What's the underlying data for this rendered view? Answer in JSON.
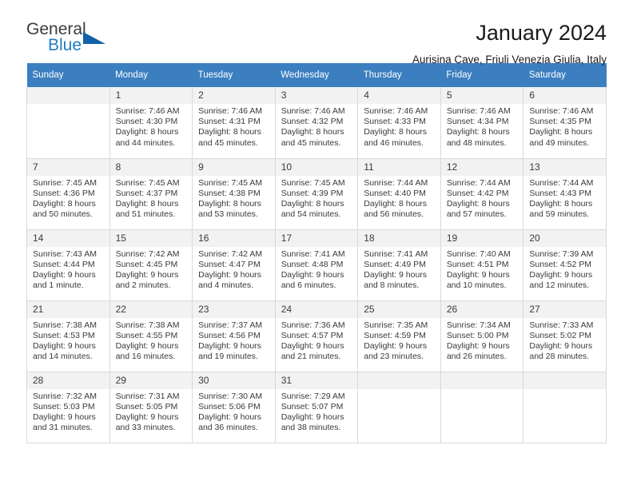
{
  "brand": {
    "name_part1": "General",
    "name_part2": "Blue",
    "triangle_color": "#1162a8",
    "blue_color": "#1f7cc4"
  },
  "header": {
    "title": "January 2024",
    "location": "Aurisina Cave, Friuli Venezia Giulia, Italy"
  },
  "theme": {
    "header_row_bg": "#3c7fc0",
    "daynum_bg": "#f2f2f2",
    "cell_border": "#d9d9d9",
    "text": "#3a3a3a"
  },
  "weekday_headers": [
    "Sunday",
    "Monday",
    "Tuesday",
    "Wednesday",
    "Thursday",
    "Friday",
    "Saturday"
  ],
  "weeks": [
    [
      {
        "day": "",
        "empty": true,
        "sunrise": "",
        "sunset": "",
        "daylight1": "",
        "daylight2": ""
      },
      {
        "day": "1",
        "sunrise": "Sunrise: 7:46 AM",
        "sunset": "Sunset: 4:30 PM",
        "daylight1": "Daylight: 8 hours",
        "daylight2": "and 44 minutes."
      },
      {
        "day": "2",
        "sunrise": "Sunrise: 7:46 AM",
        "sunset": "Sunset: 4:31 PM",
        "daylight1": "Daylight: 8 hours",
        "daylight2": "and 45 minutes."
      },
      {
        "day": "3",
        "sunrise": "Sunrise: 7:46 AM",
        "sunset": "Sunset: 4:32 PM",
        "daylight1": "Daylight: 8 hours",
        "daylight2": "and 45 minutes."
      },
      {
        "day": "4",
        "sunrise": "Sunrise: 7:46 AM",
        "sunset": "Sunset: 4:33 PM",
        "daylight1": "Daylight: 8 hours",
        "daylight2": "and 46 minutes."
      },
      {
        "day": "5",
        "sunrise": "Sunrise: 7:46 AM",
        "sunset": "Sunset: 4:34 PM",
        "daylight1": "Daylight: 8 hours",
        "daylight2": "and 48 minutes."
      },
      {
        "day": "6",
        "sunrise": "Sunrise: 7:46 AM",
        "sunset": "Sunset: 4:35 PM",
        "daylight1": "Daylight: 8 hours",
        "daylight2": "and 49 minutes."
      }
    ],
    [
      {
        "day": "7",
        "sunrise": "Sunrise: 7:45 AM",
        "sunset": "Sunset: 4:36 PM",
        "daylight1": "Daylight: 8 hours",
        "daylight2": "and 50 minutes."
      },
      {
        "day": "8",
        "sunrise": "Sunrise: 7:45 AM",
        "sunset": "Sunset: 4:37 PM",
        "daylight1": "Daylight: 8 hours",
        "daylight2": "and 51 minutes."
      },
      {
        "day": "9",
        "sunrise": "Sunrise: 7:45 AM",
        "sunset": "Sunset: 4:38 PM",
        "daylight1": "Daylight: 8 hours",
        "daylight2": "and 53 minutes."
      },
      {
        "day": "10",
        "sunrise": "Sunrise: 7:45 AM",
        "sunset": "Sunset: 4:39 PM",
        "daylight1": "Daylight: 8 hours",
        "daylight2": "and 54 minutes."
      },
      {
        "day": "11",
        "sunrise": "Sunrise: 7:44 AM",
        "sunset": "Sunset: 4:40 PM",
        "daylight1": "Daylight: 8 hours",
        "daylight2": "and 56 minutes."
      },
      {
        "day": "12",
        "sunrise": "Sunrise: 7:44 AM",
        "sunset": "Sunset: 4:42 PM",
        "daylight1": "Daylight: 8 hours",
        "daylight2": "and 57 minutes."
      },
      {
        "day": "13",
        "sunrise": "Sunrise: 7:44 AM",
        "sunset": "Sunset: 4:43 PM",
        "daylight1": "Daylight: 8 hours",
        "daylight2": "and 59 minutes."
      }
    ],
    [
      {
        "day": "14",
        "sunrise": "Sunrise: 7:43 AM",
        "sunset": "Sunset: 4:44 PM",
        "daylight1": "Daylight: 9 hours",
        "daylight2": "and 1 minute."
      },
      {
        "day": "15",
        "sunrise": "Sunrise: 7:42 AM",
        "sunset": "Sunset: 4:45 PM",
        "daylight1": "Daylight: 9 hours",
        "daylight2": "and 2 minutes."
      },
      {
        "day": "16",
        "sunrise": "Sunrise: 7:42 AM",
        "sunset": "Sunset: 4:47 PM",
        "daylight1": "Daylight: 9 hours",
        "daylight2": "and 4 minutes."
      },
      {
        "day": "17",
        "sunrise": "Sunrise: 7:41 AM",
        "sunset": "Sunset: 4:48 PM",
        "daylight1": "Daylight: 9 hours",
        "daylight2": "and 6 minutes."
      },
      {
        "day": "18",
        "sunrise": "Sunrise: 7:41 AM",
        "sunset": "Sunset: 4:49 PM",
        "daylight1": "Daylight: 9 hours",
        "daylight2": "and 8 minutes."
      },
      {
        "day": "19",
        "sunrise": "Sunrise: 7:40 AM",
        "sunset": "Sunset: 4:51 PM",
        "daylight1": "Daylight: 9 hours",
        "daylight2": "and 10 minutes."
      },
      {
        "day": "20",
        "sunrise": "Sunrise: 7:39 AM",
        "sunset": "Sunset: 4:52 PM",
        "daylight1": "Daylight: 9 hours",
        "daylight2": "and 12 minutes."
      }
    ],
    [
      {
        "day": "21",
        "sunrise": "Sunrise: 7:38 AM",
        "sunset": "Sunset: 4:53 PM",
        "daylight1": "Daylight: 9 hours",
        "daylight2": "and 14 minutes."
      },
      {
        "day": "22",
        "sunrise": "Sunrise: 7:38 AM",
        "sunset": "Sunset: 4:55 PM",
        "daylight1": "Daylight: 9 hours",
        "daylight2": "and 16 minutes."
      },
      {
        "day": "23",
        "sunrise": "Sunrise: 7:37 AM",
        "sunset": "Sunset: 4:56 PM",
        "daylight1": "Daylight: 9 hours",
        "daylight2": "and 19 minutes."
      },
      {
        "day": "24",
        "sunrise": "Sunrise: 7:36 AM",
        "sunset": "Sunset: 4:57 PM",
        "daylight1": "Daylight: 9 hours",
        "daylight2": "and 21 minutes."
      },
      {
        "day": "25",
        "sunrise": "Sunrise: 7:35 AM",
        "sunset": "Sunset: 4:59 PM",
        "daylight1": "Daylight: 9 hours",
        "daylight2": "and 23 minutes."
      },
      {
        "day": "26",
        "sunrise": "Sunrise: 7:34 AM",
        "sunset": "Sunset: 5:00 PM",
        "daylight1": "Daylight: 9 hours",
        "daylight2": "and 26 minutes."
      },
      {
        "day": "27",
        "sunrise": "Sunrise: 7:33 AM",
        "sunset": "Sunset: 5:02 PM",
        "daylight1": "Daylight: 9 hours",
        "daylight2": "and 28 minutes."
      }
    ],
    [
      {
        "day": "28",
        "sunrise": "Sunrise: 7:32 AM",
        "sunset": "Sunset: 5:03 PM",
        "daylight1": "Daylight: 9 hours",
        "daylight2": "and 31 minutes."
      },
      {
        "day": "29",
        "sunrise": "Sunrise: 7:31 AM",
        "sunset": "Sunset: 5:05 PM",
        "daylight1": "Daylight: 9 hours",
        "daylight2": "and 33 minutes."
      },
      {
        "day": "30",
        "sunrise": "Sunrise: 7:30 AM",
        "sunset": "Sunset: 5:06 PM",
        "daylight1": "Daylight: 9 hours",
        "daylight2": "and 36 minutes."
      },
      {
        "day": "31",
        "sunrise": "Sunrise: 7:29 AM",
        "sunset": "Sunset: 5:07 PM",
        "daylight1": "Daylight: 9 hours",
        "daylight2": "and 38 minutes."
      },
      {
        "day": "",
        "empty": true,
        "sunrise": "",
        "sunset": "",
        "daylight1": "",
        "daylight2": ""
      },
      {
        "day": "",
        "empty": true,
        "sunrise": "",
        "sunset": "",
        "daylight1": "",
        "daylight2": ""
      },
      {
        "day": "",
        "empty": true,
        "sunrise": "",
        "sunset": "",
        "daylight1": "",
        "daylight2": ""
      }
    ]
  ]
}
